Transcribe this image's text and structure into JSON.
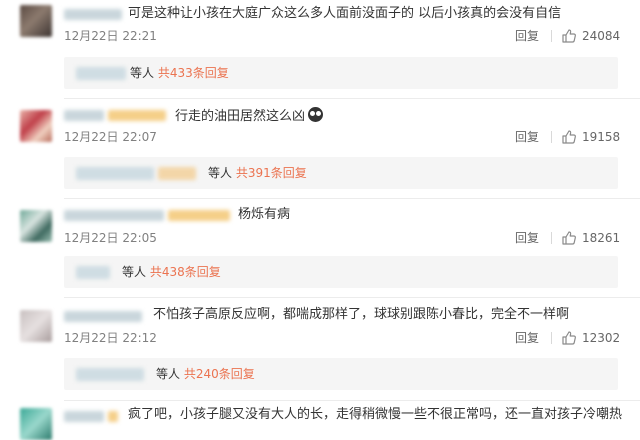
{
  "comments": [
    {
      "text": "可是这种让小孩在大庭广众这么多人面前没面子的 以后小孩真的会没有自信",
      "time": "12月22日 22:21",
      "reply_label": "回复",
      "likes": "24084",
      "thread": {
        "suffix": "等人",
        "count_text": "共433条回复"
      }
    },
    {
      "text": "行走的油田居然这么凶",
      "emoji": "angry-face-icon",
      "time": "12月22日 22:07",
      "reply_label": "回复",
      "likes": "19158",
      "thread": {
        "suffix": "等人",
        "count_text": "共391条回复"
      }
    },
    {
      "text": "杨烁有病",
      "time": "12月22日 22:05",
      "reply_label": "回复",
      "likes": "18261",
      "thread": {
        "suffix": "等人",
        "count_text": "共438条回复"
      }
    },
    {
      "text": "不怕孩子高原反应啊，都喘成那样了，球球别跟陈小春比，完全不一样啊",
      "time": "12月22日 22:12",
      "reply_label": "回复",
      "likes": "12302",
      "thread": {
        "suffix": "等人",
        "count_text": "共240条回复"
      }
    },
    {
      "text": "疯了吧，小孩子腿又没有大人的长，走得稍微慢一些不很正常吗，还一直对孩子冷嘲热"
    }
  ],
  "colors": {
    "accent": "#eb7350",
    "muted": "#808080",
    "thread_bg": "#f5f5f5"
  },
  "icons": {
    "like": "thumbs-up-icon"
  }
}
